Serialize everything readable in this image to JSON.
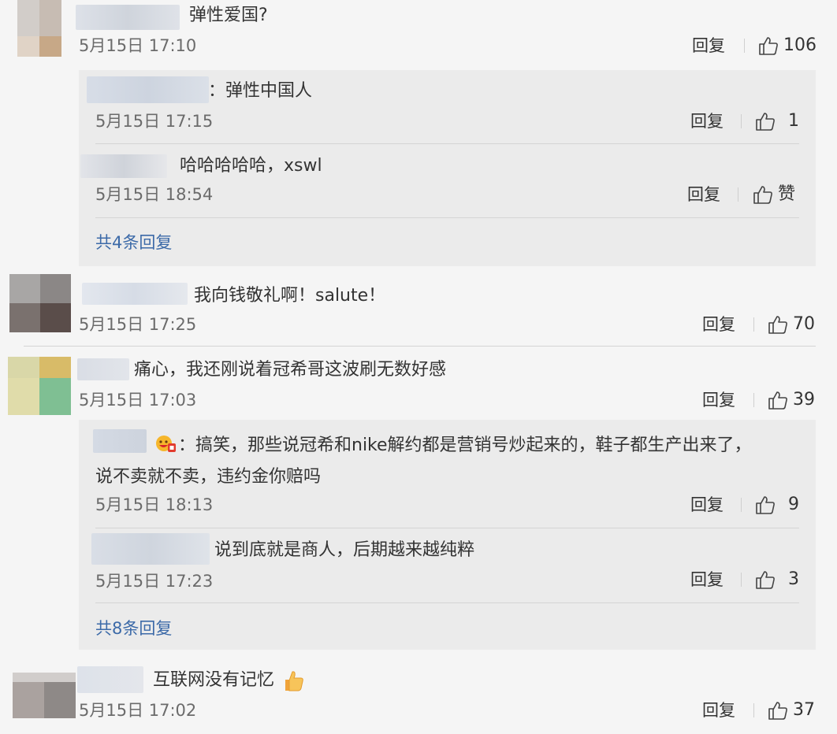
{
  "comments": [
    {
      "text": "弹性爱国?",
      "time": "5月15日 17:10",
      "reply_label": "回复",
      "likes": "106",
      "sub_replies": [
        {
          "text": "：弹性中国人",
          "time": "5月15日 17:15",
          "reply_label": "回复",
          "likes": "1"
        },
        {
          "text": "哈哈哈哈哈，xswl",
          "time": "5月15日 18:54",
          "reply_label": "回复",
          "likes": "赞"
        }
      ],
      "more_label": "共4条回复"
    },
    {
      "text": "我向钱敬礼啊！salute！",
      "time": "5月15日 17:25",
      "reply_label": "回复",
      "likes": "70"
    },
    {
      "text": "痛心，我还刚说着冠希哥这波刷无数好感",
      "time": "5月15日 17:03",
      "reply_label": "回复",
      "likes": "39",
      "sub_replies": [
        {
          "text_line1": "：搞笑，那些说冠希和nike解约都是营销号炒起来的，鞋子都生产出来了，",
          "text_line2": "说不卖就不卖，违约金你赔吗",
          "time": "5月15日 18:13",
          "reply_label": "回复",
          "likes": "9"
        },
        {
          "text": "说到底就是商人，后期越来越纯粹",
          "time": "5月15日 17:23",
          "reply_label": "回复",
          "likes": "3"
        }
      ],
      "more_label": "共8条回复"
    },
    {
      "text": "互联网没有记忆",
      "time": "5月15日 17:02",
      "reply_label": "回复",
      "likes": "37"
    }
  ],
  "icons": {
    "like": "thumbs-up-icon",
    "emoji_thumb": "thumbs-up-emoji",
    "emoji_face": "smiling-face-emoji"
  },
  "colors": {
    "link": "#3c6aa8",
    "panel": "#ebebeb",
    "background": "#f5f5f5"
  }
}
